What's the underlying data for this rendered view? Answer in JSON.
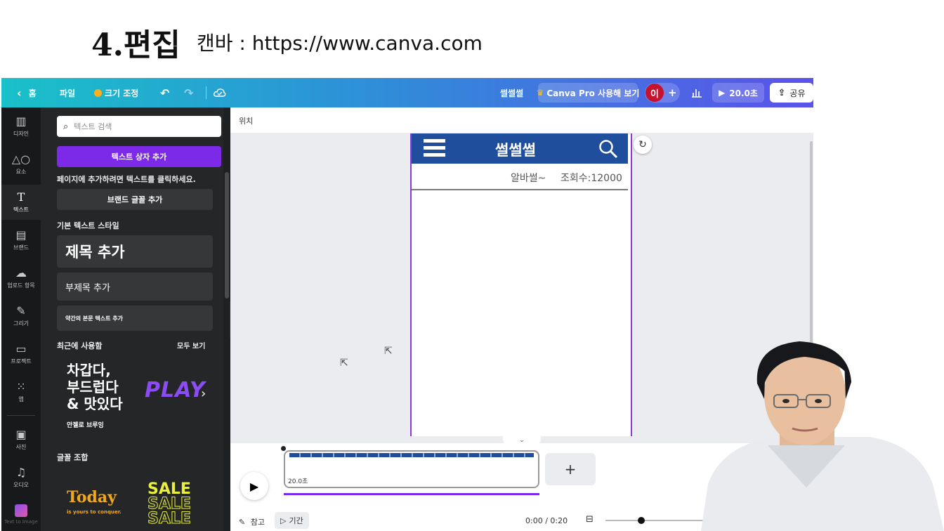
{
  "slide": {
    "title": "4.편집",
    "subtitle": "캔바 : https://www.canva.com"
  },
  "topbar": {
    "home": "홈",
    "file": "파일",
    "resize": "크기 조정",
    "doc_name": "썰썰썰",
    "pro_promo": "Canva Pro 사용해 보기",
    "avatar": "이",
    "present_duration": "20.0초",
    "share": "공유"
  },
  "rail": [
    {
      "label": "디자인",
      "icon": "layout-icon"
    },
    {
      "label": "요소",
      "icon": "shapes-icon"
    },
    {
      "label": "텍스트",
      "icon": "text-icon"
    },
    {
      "label": "브랜드",
      "icon": "brand-icon"
    },
    {
      "label": "업로드 항목",
      "icon": "upload-icon"
    },
    {
      "label": "그리기",
      "icon": "draw-icon"
    },
    {
      "label": "프로젝트",
      "icon": "folder-icon"
    },
    {
      "label": "앱",
      "icon": "apps-icon"
    },
    {
      "label": "사진",
      "icon": "photo-icon"
    },
    {
      "label": "오디오",
      "icon": "audio-icon"
    },
    {
      "label": "Text to Image",
      "icon": "text-to-image-icon"
    }
  ],
  "panel": {
    "search_placeholder": "텍스트 검색",
    "add_textbox": "텍스트 상자 추가",
    "hint": "페이지에 추가하려면 텍스트를 클릭하세요.",
    "brand_fonts": "브랜드 글꼴 추가",
    "default_styles": "기본 텍스트 스타일",
    "heading": "제목 추가",
    "subheading": "부제목 추가",
    "body": "약간의 본문 텍스트 추가",
    "recent": "최근에 사용함",
    "see_all": "모두 보기",
    "recent_card1_lines": [
      "차갑다,",
      "부드럽다",
      "& 맛있다"
    ],
    "recent_card1_caption": "안젤로 브루잉",
    "recent_card2": "PLAY",
    "combos": "글꼴 조합",
    "combo1_title": "Today",
    "combo1_sub": "is yours to conquer.",
    "combo2": "SALE"
  },
  "canvas": {
    "position_label": "위치",
    "page_title": "썰썰썰",
    "author": "알바썰~",
    "views": "조회수:12000"
  },
  "timeline": {
    "clip_duration": "20.0초",
    "notes": "참고",
    "duration": "기간",
    "time": "0:00 / 0:20"
  },
  "colors": {
    "accent_purple": "#7d2ae8",
    "page_header_blue": "#1f4e9c",
    "panel_bg": "#252627",
    "rail_bg": "#18191b",
    "avatar_red": "#c4122f"
  }
}
